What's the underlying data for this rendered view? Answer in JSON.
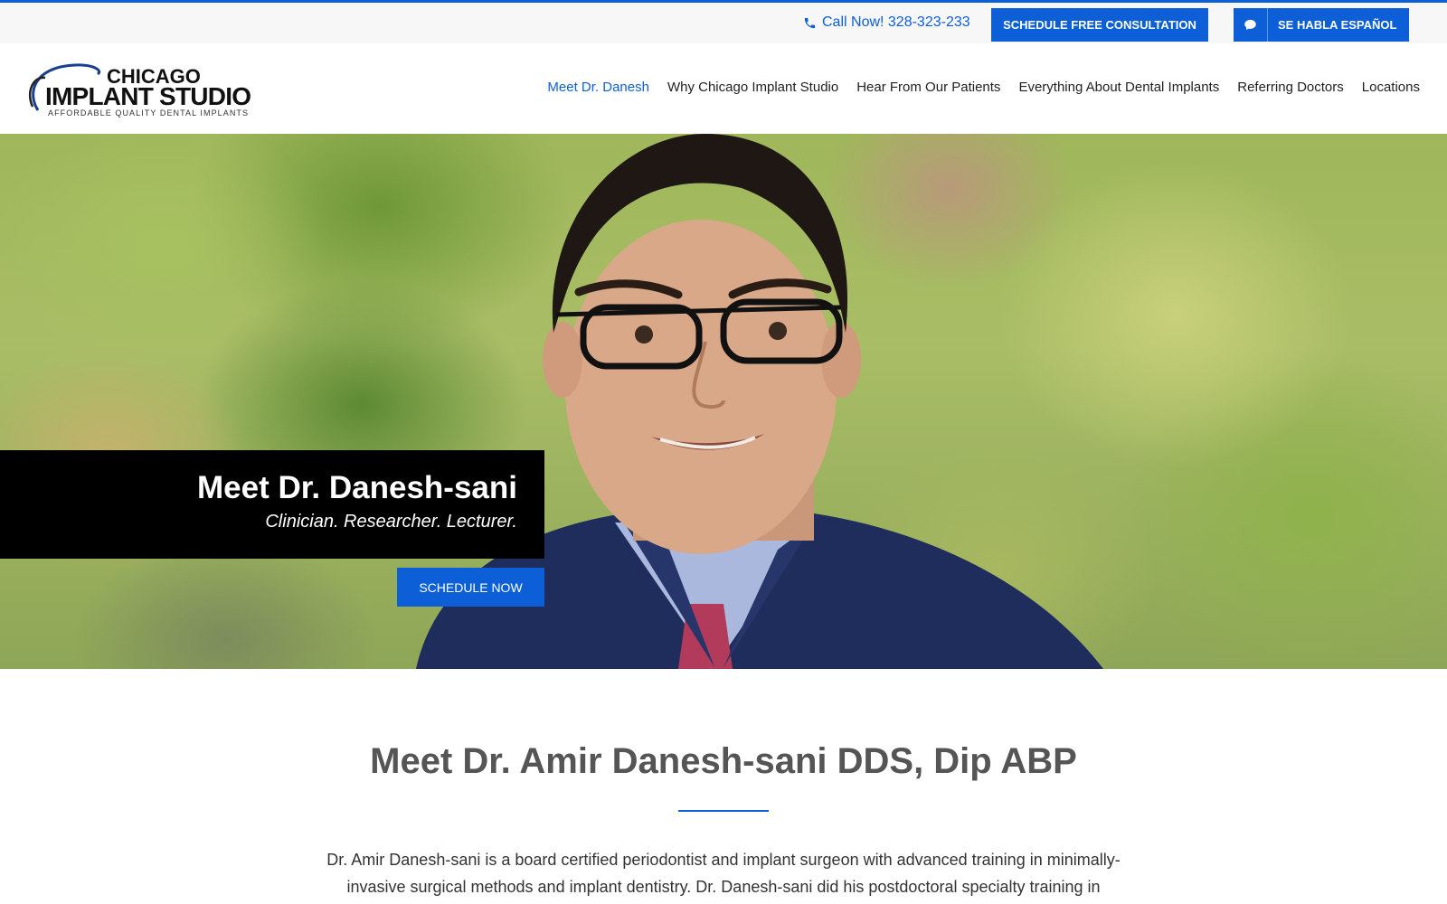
{
  "topbar": {
    "call_label": "Call Now! 328-323-233",
    "consult_button": "SCHEDULE FREE CONSULTATION",
    "espanol_button": "SE HABLA ESPAÑOL",
    "icons": {
      "phone": "phone-icon",
      "chat": "chat-bubble-icon"
    }
  },
  "logo": {
    "line1": "CHICAGO",
    "line2": "IMPLANT STUDIO",
    "tagline": "AFFORDABLE QUALITY DENTAL IMPLANTS"
  },
  "nav": {
    "items": [
      {
        "label": "Meet Dr. Danesh",
        "active": true
      },
      {
        "label": "Why Chicago Implant Studio",
        "active": false
      },
      {
        "label": "Hear From Our Patients",
        "active": false
      },
      {
        "label": "Everything About Dental Implants",
        "active": false
      },
      {
        "label": "Referring Doctors",
        "active": false
      },
      {
        "label": "Locations",
        "active": false
      }
    ]
  },
  "hero": {
    "title": "Meet Dr. Danesh-sani",
    "subtitle": "Clinician. Researcher. Lecturer.",
    "cta": "SCHEDULE NOW"
  },
  "content": {
    "heading": "Meet Dr. Amir Danesh-sani DDS, Dip ABP",
    "body": "Dr. Amir Danesh-sani is a board certified periodontist and implant surgeon with advanced training in minimally-invasive surgical methods and implant dentistry. Dr. Danesh-sani did his postdoctoral specialty training in"
  },
  "colors": {
    "accent": "#0d5fd8",
    "text": "#222222",
    "heading": "#555555",
    "topbar_bg": "#f7f7f7"
  }
}
